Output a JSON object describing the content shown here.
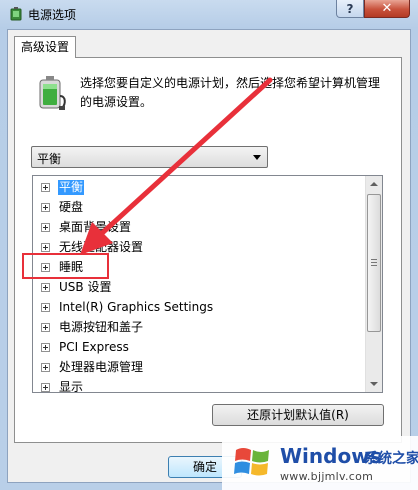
{
  "window": {
    "title": "电源选项",
    "help_label": "?",
    "close_label": "✕"
  },
  "tab": {
    "label": "高级设置"
  },
  "description": "选择您要自定义的电源计划，然后选择您希望计算机管理的电源设置。",
  "plan_select": {
    "selected": "平衡"
  },
  "tree": {
    "items": [
      {
        "label": "平衡",
        "selected": true
      },
      {
        "label": "硬盘"
      },
      {
        "label": "桌面背景设置"
      },
      {
        "label": "无线适配器设置"
      },
      {
        "label": "睡眠"
      },
      {
        "label": "USB 设置"
      },
      {
        "label": "Intel(R) Graphics Settings"
      },
      {
        "label": "电源按钮和盖子"
      },
      {
        "label": "PCI Express"
      },
      {
        "label": "处理器电源管理"
      },
      {
        "label": "显示"
      }
    ]
  },
  "buttons": {
    "restore_defaults": "还原计划默认值(R)",
    "ok": "确定"
  },
  "icons": {
    "title": "power-options-icon",
    "battery": "battery-plug-icon",
    "expander": "plus-box-icon"
  },
  "annotation": {
    "color": "#e8303a"
  },
  "watermark": {
    "brand": "Windows",
    "brand_cn": "系统之家",
    "url": "www.bjjmlv.com"
  }
}
